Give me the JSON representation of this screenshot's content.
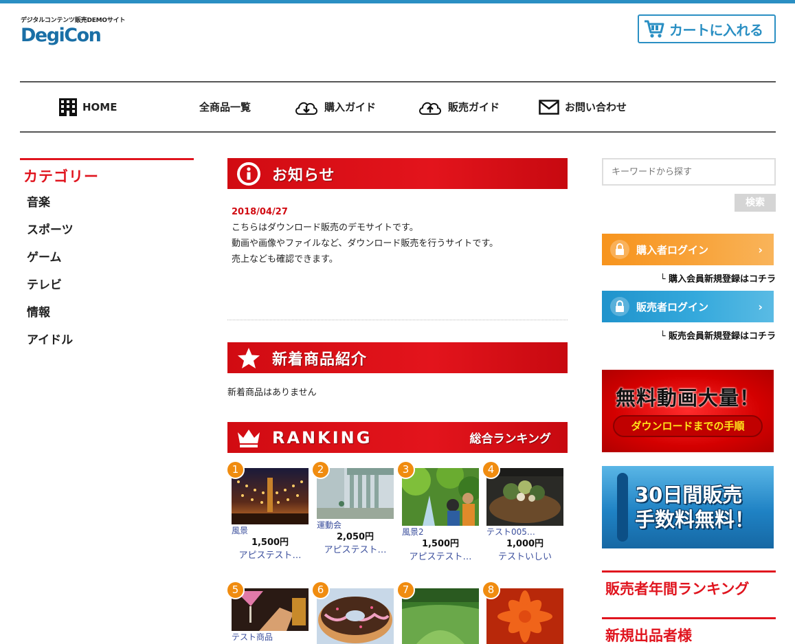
{
  "header": {
    "tagline": "デジタルコンテンツ販売DEMOサイト",
    "logo": "DegiCon",
    "cart_label": "カートに入れる"
  },
  "nav": [
    {
      "label": "HOME",
      "icon": "building-icon"
    },
    {
      "label": "全商品一覧",
      "icon": ""
    },
    {
      "label": "購入ガイド",
      "icon": "cloud-download-icon"
    },
    {
      "label": "販売ガイド",
      "icon": "cloud-upload-icon"
    },
    {
      "label": "お問い合わせ",
      "icon": "mail-icon"
    }
  ],
  "category": {
    "title": "カテゴリー",
    "items": [
      "音楽",
      "スポーツ",
      "ゲーム",
      "テレビ",
      "情報",
      "アイドル"
    ]
  },
  "news": {
    "title": "お知らせ",
    "date": "2018/04/27",
    "lines": [
      "こちらはダウンロード販売のデモサイトです。",
      "動画や画像やファイルなど、ダウンロード販売を行うサイトです。",
      "売上なども確認できます。"
    ]
  },
  "new_items": {
    "title": "新着商品紹介",
    "empty": "新着商品はありません"
  },
  "ranking": {
    "title": "RANKING",
    "subtitle": "総合ランキング",
    "items": [
      {
        "rank": "1",
        "category": "風景",
        "price": "1,500円",
        "seller": "アピステスト…"
      },
      {
        "rank": "2",
        "category": "運動会",
        "price": "2,050円",
        "seller": "アピステスト…"
      },
      {
        "rank": "3",
        "category": "風景2",
        "price": "1,500円",
        "seller": "アピステスト…"
      },
      {
        "rank": "4",
        "category": "テスト005…",
        "price": "1,000円",
        "seller": "テストいしい"
      },
      {
        "rank": "5",
        "category": "テスト商品",
        "price": "",
        "seller": ""
      },
      {
        "rank": "6",
        "category": "",
        "price": "",
        "seller": ""
      },
      {
        "rank": "7",
        "category": "",
        "price": "",
        "seller": ""
      },
      {
        "rank": "8",
        "category": "",
        "price": "",
        "seller": ""
      }
    ]
  },
  "search": {
    "placeholder": "キーワードから探す",
    "button": "検索"
  },
  "login": {
    "buyer": "購入者ログイン",
    "buyer_register": "└ 購入会員新規登録はコチラ",
    "seller": "販売者ログイン",
    "seller_register": "└ 販売会員新規登録はコチラ"
  },
  "banners": {
    "free_video": "無料動画大量！",
    "free_video_sub": "ダウンロードまでの手順",
    "sales_line1": "30日間販売",
    "sales_line2": "手数料無料！"
  },
  "side_headings": {
    "seller_ranking": "販売者年間ランキング",
    "new_sellers": "新規出品者様"
  },
  "colors": {
    "accent_blue": "#2a8fc3",
    "accent_red": "#e0141e",
    "orange": "#f7941d",
    "sky": "#29a3d6"
  }
}
